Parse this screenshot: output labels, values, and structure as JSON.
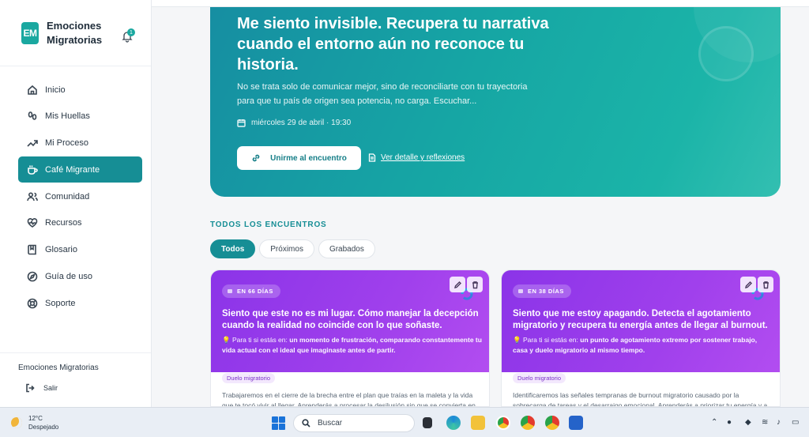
{
  "brand": {
    "logo": "EM",
    "name": "Emociones Migratorias",
    "notifications": "1"
  },
  "nav": [
    {
      "label": "Inicio",
      "icon": "home-icon",
      "active": false
    },
    {
      "label": "Mis Huellas",
      "icon": "footprints-icon",
      "active": false
    },
    {
      "label": "Mi Proceso",
      "icon": "trend-icon",
      "active": false
    },
    {
      "label": "Café Migrante",
      "icon": "coffee-icon",
      "active": true
    },
    {
      "label": "Comunidad",
      "icon": "users-icon",
      "active": false
    },
    {
      "label": "Recursos",
      "icon": "heart-pulse-icon",
      "active": false
    },
    {
      "label": "Glosario",
      "icon": "book-icon",
      "active": false
    },
    {
      "label": "Guía de uso",
      "icon": "compass-icon",
      "active": false
    },
    {
      "label": "Soporte",
      "icon": "lifebuoy-icon",
      "active": false
    }
  ],
  "sidebar_footer": {
    "title": "Emociones Migratorias",
    "logout": "Salir"
  },
  "hero": {
    "title": "Me siento invisible. Recupera tu narrativa cuando el entorno aún no reconoce tu historia.",
    "description": "No se trata solo de comunicar mejor, sino de reconciliarte con tu trayectoria para que tu país de origen sea potencia, no carga. Escuchar...",
    "date": "miércoles 29 de abril · 19:30",
    "join_label": "Unirme al encuentro",
    "detail_label": "Ver detalle y reflexiones"
  },
  "section": {
    "title": "TODOS LOS ENCUENTROS",
    "filters": [
      "Todos",
      "Próximos",
      "Grabados"
    ]
  },
  "cards": [
    {
      "badge": "EN 66 DÍAS",
      "title": "Siento que este no es mi lugar. Cómo manejar la decepción cuando la realidad no coincide con lo que soñaste.",
      "note_prefix": "💡 Para ti si estás en:",
      "note_text": "un momento de frustración, comparando constantemente tu vida actual con el ideal que imaginaste antes de partir.",
      "tag": "Duelo migratorio",
      "body": "Trabajaremos en el cierre de la brecha entre el plan que traías en la maleta y la vida que te tocó vivir al llegar. Aprenderás a procesar la desilusión sin que se convierta en..."
    },
    {
      "badge": "EN 38 DÍAS",
      "title": "Siento que me estoy apagando. Detecta el agotamiento migratorio y recupera tu energía antes de llegar al burnout.",
      "note_prefix": "💡 Para ti si estás en:",
      "note_text": "un punto de agotamiento extremo por sostener trabajo, casa y duelo migratorio al mismo tiempo.",
      "tag": "Duelo migratorio",
      "body": "Identificaremos las señales tempranas de burnout migratorio causado por la sobrecarga de tareas y el desarraigo emocional. Aprenderás a priorizar tu energía y a..."
    }
  ],
  "taskbar": {
    "weather_temp": "12°C",
    "weather_desc": "Despejado",
    "search_placeholder": "Buscar"
  },
  "colors": {
    "accent": "#168e95",
    "card_purple": "#9b3ded",
    "hero_teal": "#16a6a4"
  }
}
